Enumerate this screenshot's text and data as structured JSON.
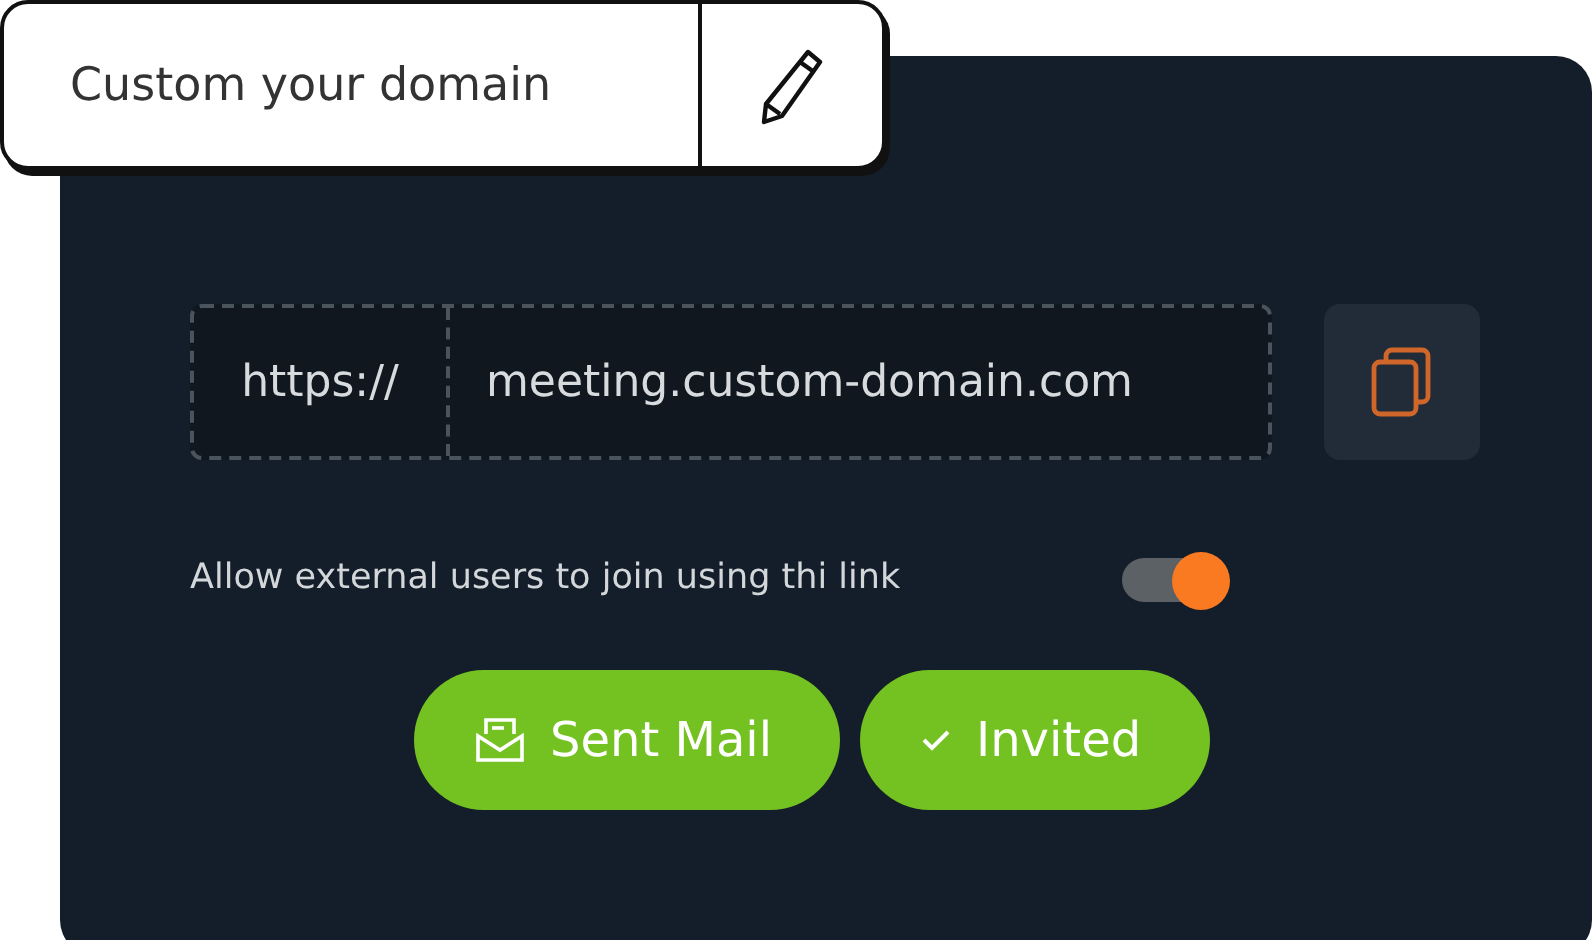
{
  "header": {
    "title": "Custom your domain"
  },
  "url": {
    "prefix": "https://",
    "value": "meeting.custom-domain.com"
  },
  "setting": {
    "label": "Allow external users to join using thi link",
    "on": true
  },
  "buttons": [
    {
      "label": "Sent Mail",
      "kind": "mail"
    },
    {
      "label": "Invited",
      "kind": "check"
    }
  ]
}
